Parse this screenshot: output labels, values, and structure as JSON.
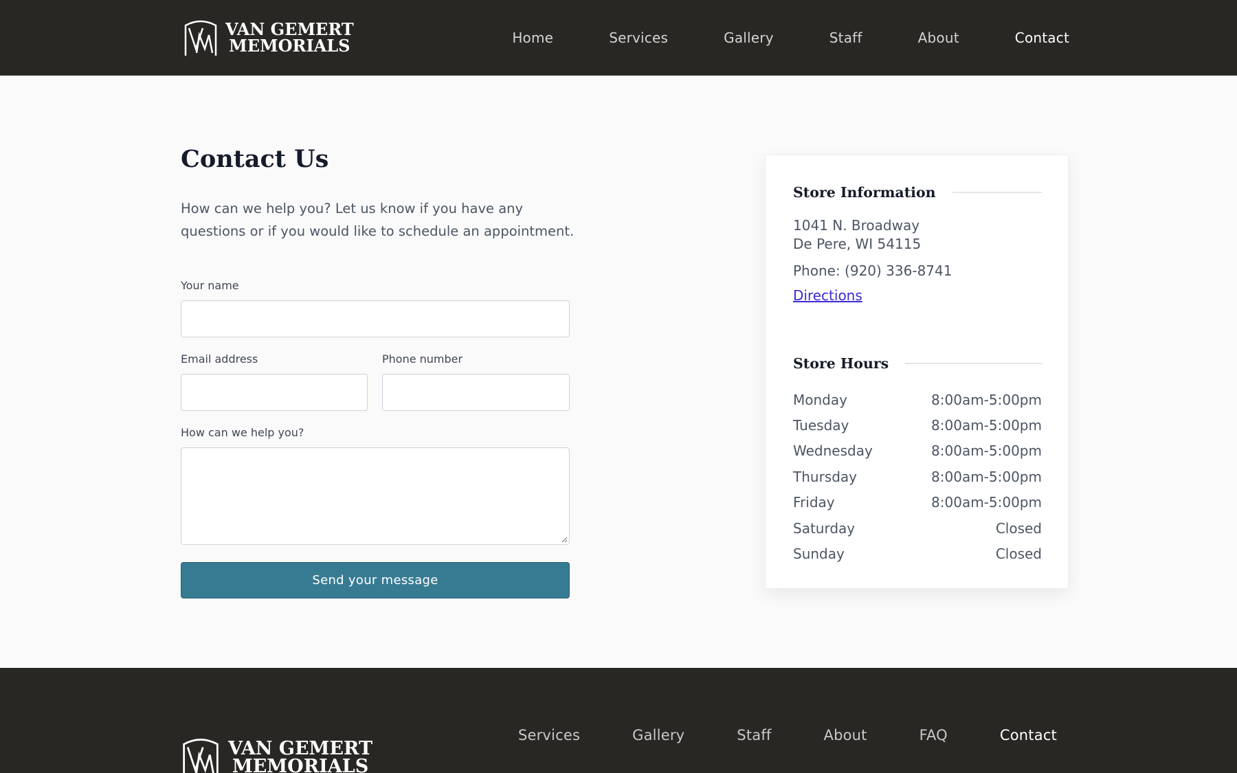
{
  "brand": {
    "line1": "VAN GEMERT",
    "line2": "MEMORIALS"
  },
  "header_nav": [
    {
      "label": "Home",
      "active": false
    },
    {
      "label": "Services",
      "active": false
    },
    {
      "label": "Gallery",
      "active": false
    },
    {
      "label": "Staff",
      "active": false
    },
    {
      "label": "About",
      "active": false
    },
    {
      "label": "Contact",
      "active": true
    }
  ],
  "contact": {
    "title": "Contact Us",
    "intro": "How can we help you? Let us know if you have any questions or if you would like to schedule an appointment.",
    "form": {
      "name_label": "Your name",
      "name_value": "",
      "email_label": "Email address",
      "email_value": "",
      "phone_label": "Phone number",
      "phone_value": "",
      "message_label": "How can we help you?",
      "message_value": "",
      "submit_label": "Send your message"
    }
  },
  "store_info": {
    "heading": "Store Information",
    "address_line1": "1041 N. Broadway",
    "address_line2": "De Pere, WI 54115",
    "phone": "Phone: (920) 336-8741",
    "directions_label": "Directions"
  },
  "store_hours": {
    "heading": "Store Hours",
    "rows": [
      {
        "day": "Monday",
        "hours": "8:00am-5:00pm"
      },
      {
        "day": "Tuesday",
        "hours": "8:00am-5:00pm"
      },
      {
        "day": "Wednesday",
        "hours": "8:00am-5:00pm"
      },
      {
        "day": "Thursday",
        "hours": "8:00am-5:00pm"
      },
      {
        "day": "Friday",
        "hours": "8:00am-5:00pm"
      },
      {
        "day": "Saturday",
        "hours": "Closed"
      },
      {
        "day": "Sunday",
        "hours": "Closed"
      }
    ]
  },
  "footer_nav": [
    {
      "label": "Services",
      "active": false
    },
    {
      "label": "Gallery",
      "active": false
    },
    {
      "label": "Staff",
      "active": false
    },
    {
      "label": "About",
      "active": false
    },
    {
      "label": "FAQ",
      "active": false
    },
    {
      "label": "Contact",
      "active": true
    }
  ],
  "colors": {
    "header_bg": "#282723",
    "button_bg": "#377b92",
    "link": "#3b2ad6",
    "page_bg": "#fafafa"
  },
  "icons": {
    "logo": "vm-monogram-icon"
  }
}
